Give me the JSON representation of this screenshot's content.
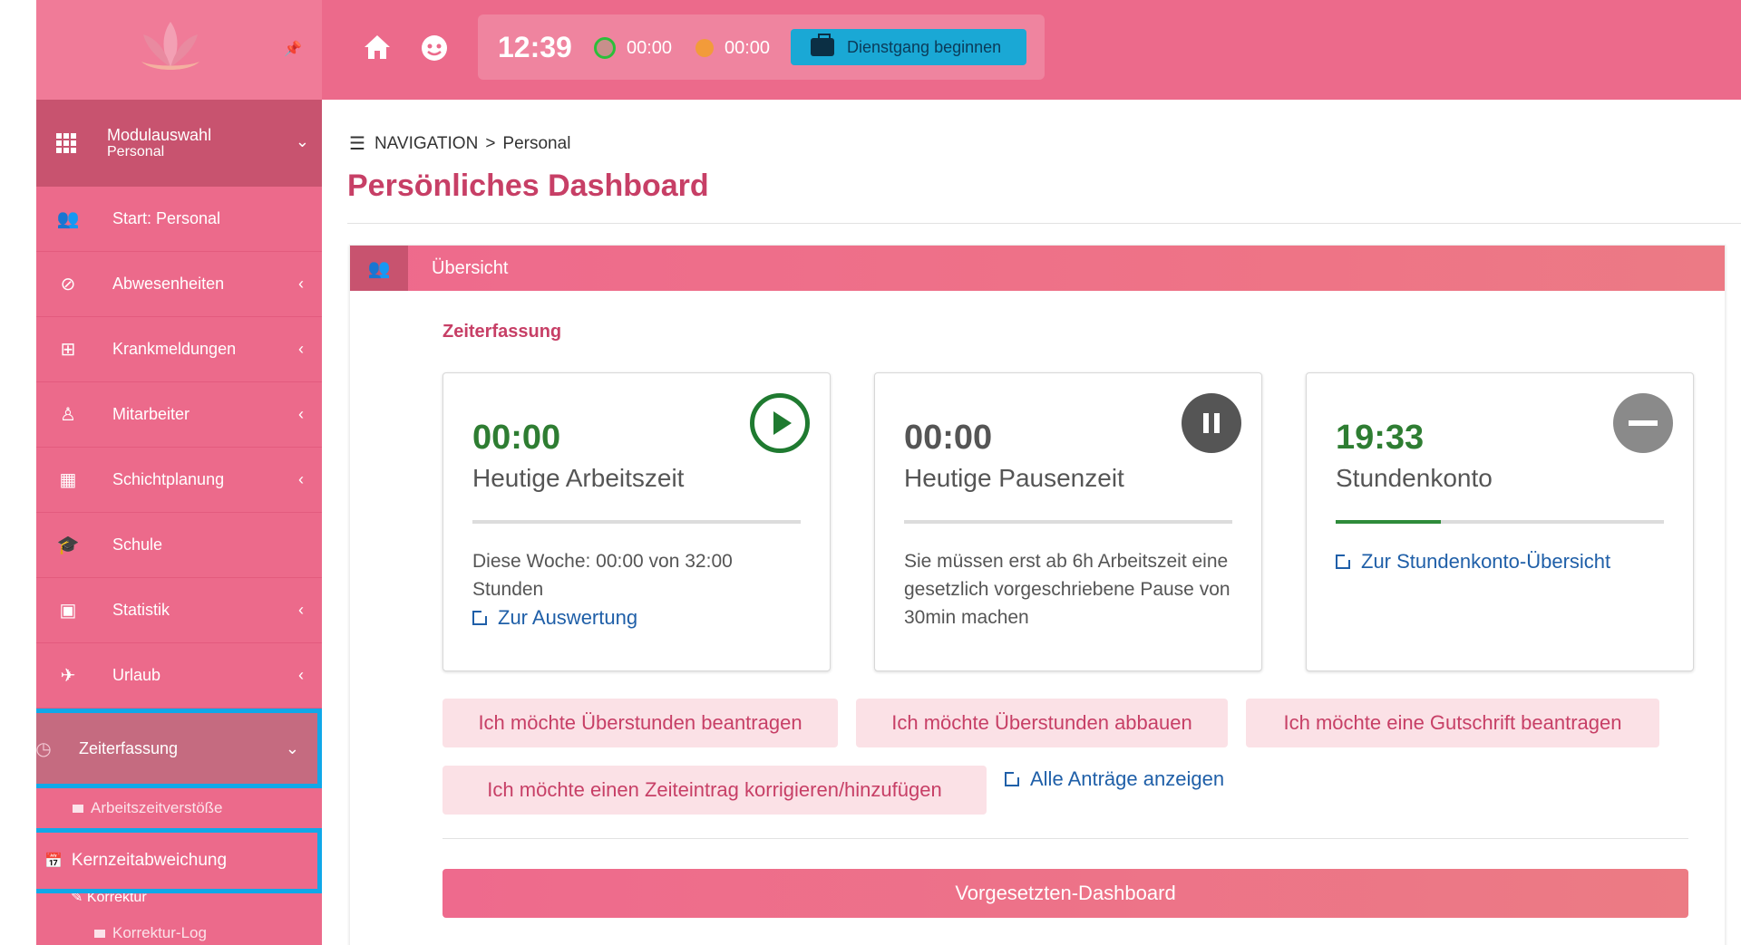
{
  "topbar": {
    "time": "12:39",
    "work_timer": "00:00",
    "break_timer": "00:00",
    "dienstgang_label": "Dienstgang beginnen"
  },
  "sidebar": {
    "module_title": "Modulauswahl",
    "module_sub": "Personal",
    "items": [
      {
        "label": "Start: Personal"
      },
      {
        "label": "Abwesenheiten"
      },
      {
        "label": "Krankmeldungen"
      },
      {
        "label": "Mitarbeiter"
      },
      {
        "label": "Schichtplanung"
      },
      {
        "label": "Schule"
      },
      {
        "label": "Statistik"
      },
      {
        "label": "Urlaub"
      },
      {
        "label": "Zeiterfassung"
      }
    ],
    "subitems": [
      {
        "label": "Arbeitszeitverstöße"
      },
      {
        "label": "Kernzeitabweichung"
      },
      {
        "label": "Korrektur"
      },
      {
        "label": "Korrektur-Log"
      }
    ]
  },
  "breadcrumb": {
    "root": "NAVIGATION",
    "separator": ">",
    "current": "Personal"
  },
  "page": {
    "title": "Persönliches Dashboard"
  },
  "panel": {
    "header": "Übersicht",
    "section_title": "Zeiterfassung",
    "cards": [
      {
        "value": "00:00",
        "label": "Heutige Arbeitszeit",
        "text": "Diese Woche: 00:00 von 32:00 Stunden",
        "link": "Zur Auswertung",
        "progress": 0,
        "value_color": "#2e7d32"
      },
      {
        "value": "00:00",
        "label": "Heutige Pausenzeit",
        "text": "Sie müssen erst ab 6h Arbeitszeit eine gesetzlich vorgeschriebene Pause von 30min machen",
        "progress": 0,
        "value_color": "#555555"
      },
      {
        "value": "19:33",
        "label": "Stundenkonto",
        "link": "Zur Stundenkonto-Übersicht",
        "progress": 0.32,
        "value_color": "#2e7d32"
      }
    ],
    "requests": [
      "Ich möchte Überstunden beantragen",
      "Ich möchte Überstunden abbauen",
      "Ich möchte eine Gutschrift beantragen",
      "Ich möchte einen Zeiteintrag korrigieren/hinzufügen"
    ],
    "all_requests_link": "Alle Anträge anzeigen",
    "supervisor_button": "Vorgesetzten-Dashboard"
  },
  "colors": {
    "brand_pink": "#ec6a8b",
    "highlight_blue": "#10a8e8",
    "link_blue": "#1f5fa8"
  }
}
